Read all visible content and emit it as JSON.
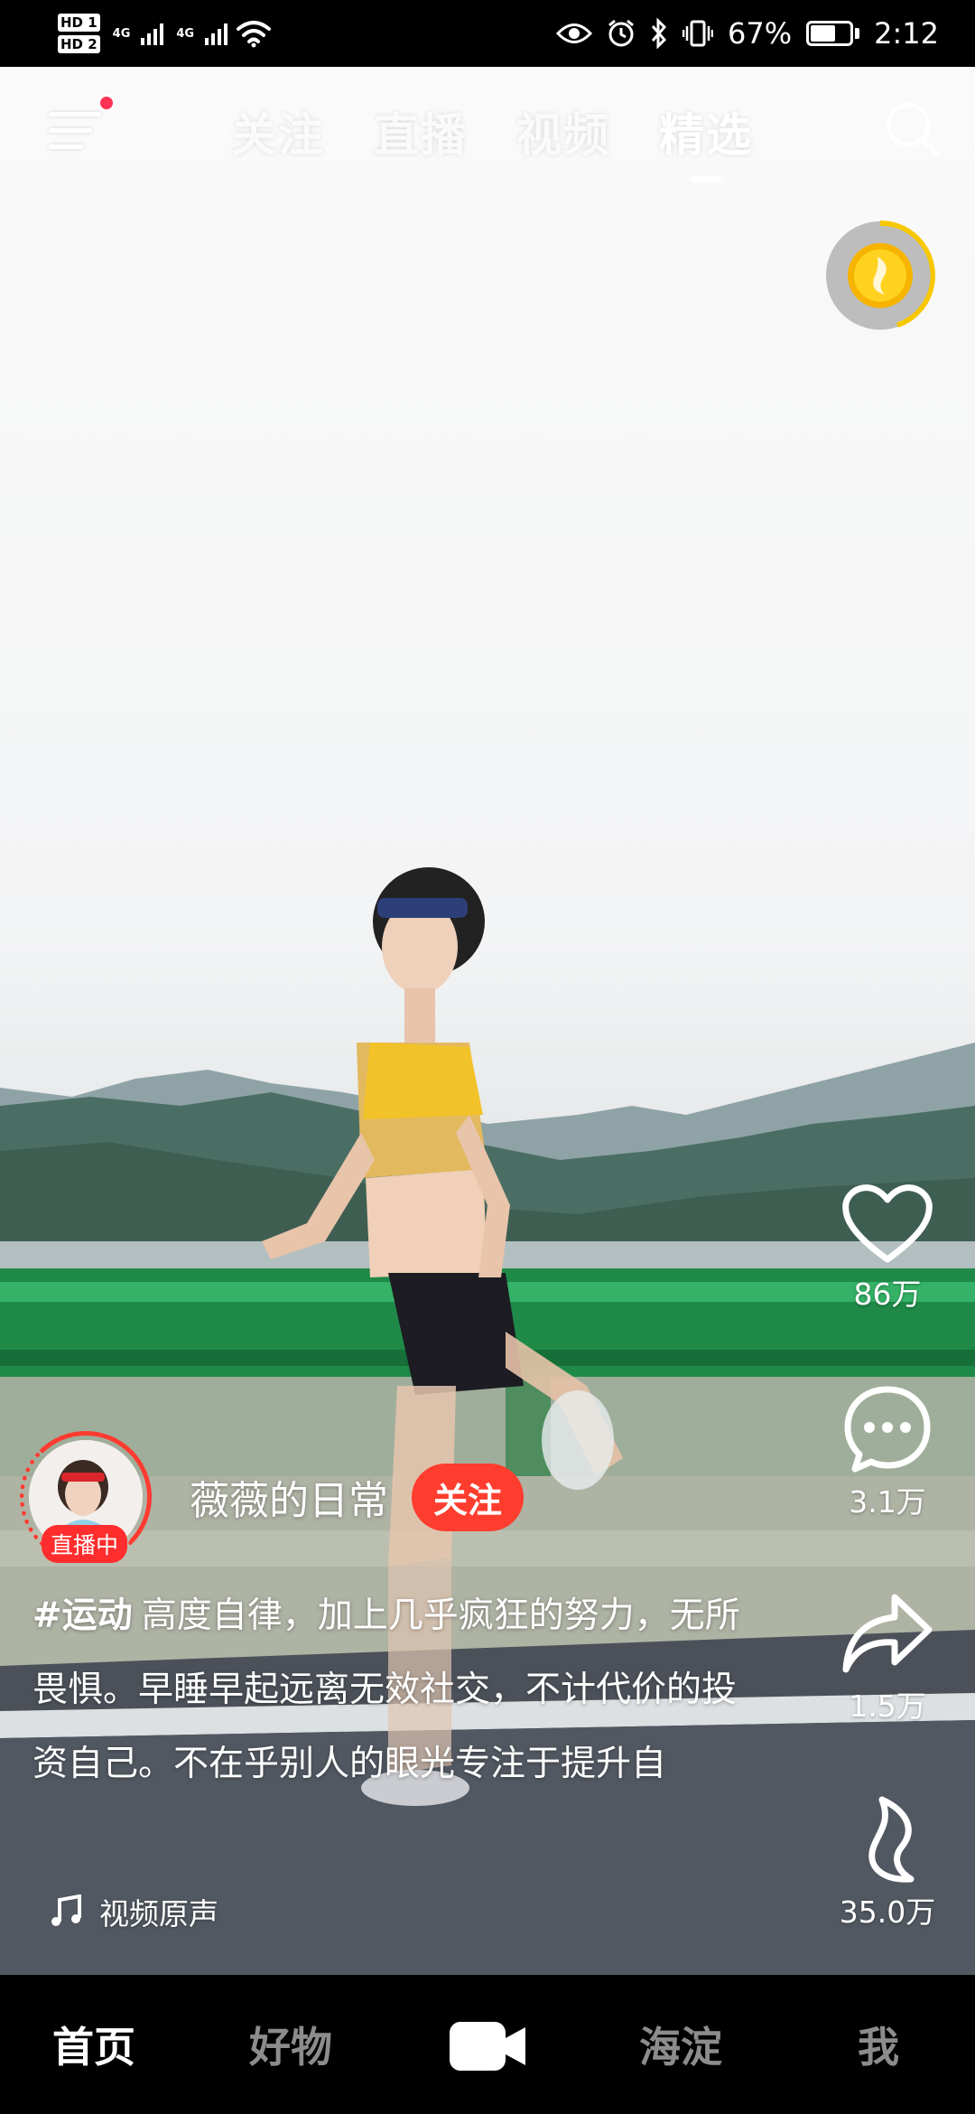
{
  "status_bar": {
    "sim1": "HD 1",
    "sim2": "HD 2",
    "net1": "4G",
    "net2": "4G",
    "battery_level": 0.67,
    "battery_text": "67%",
    "time": "2:12",
    "icons": [
      "signal-icon",
      "wifi-icon",
      "eye-icon",
      "alarm-icon",
      "bluetooth-icon",
      "vibrate-icon",
      "battery-icon"
    ]
  },
  "top_nav": {
    "tabs": [
      {
        "label": "关注",
        "active": false
      },
      {
        "label": "直播",
        "active": false
      },
      {
        "label": "视频",
        "active": false
      },
      {
        "label": "精选",
        "active": true
      }
    ],
    "icons": [
      "menu-icon",
      "search-icon"
    ]
  },
  "actions": {
    "like_count": "86万",
    "comment_count": "3.1万",
    "share_count": "1.5万",
    "collect_count": "35.0万"
  },
  "author": {
    "name": "薇薇的日常",
    "live_badge": "直播中",
    "follow_label": "关注"
  },
  "caption": {
    "hashtag": "#运动",
    "text": "高度自律，加上几乎疯狂的努力，无所畏惧。早睡早起远离无效社交，不计代价的投资自己。不在乎别人的眼光专注于提升自"
  },
  "music": {
    "label": "视频原声"
  },
  "bottom_nav": {
    "items": [
      "首页",
      "好物",
      "海淀",
      "我"
    ],
    "active": "首页",
    "camera_icon": "camera-icon"
  },
  "colors": {
    "accent_red": "#ff3d2e",
    "coin_gold": "#f6b400"
  }
}
